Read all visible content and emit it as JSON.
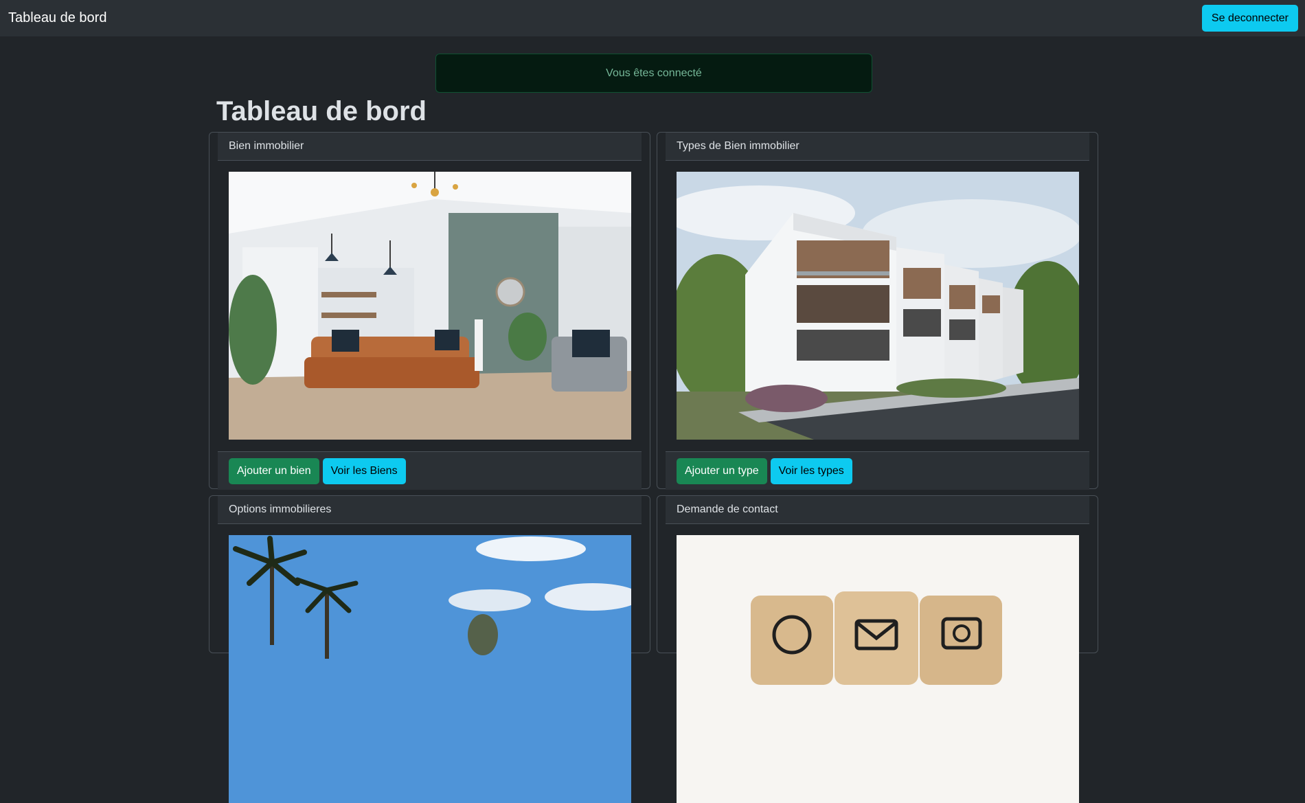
{
  "navbar": {
    "brand": "Tableau de bord",
    "logout_label": "Se deconnecter"
  },
  "alert": {
    "message": "Vous êtes connecté"
  },
  "page": {
    "title": "Tableau de bord"
  },
  "cards": {
    "biens": {
      "title": "Bien immobilier",
      "add_label": "Ajouter un bien",
      "view_label": "Voir les Biens"
    },
    "types": {
      "title": "Types de Bien immobilier",
      "add_label": "Ajouter un type",
      "view_label": "Voir les types"
    },
    "options": {
      "title": "Options immobilieres"
    },
    "contact": {
      "title": "Demande de contact"
    }
  },
  "colors": {
    "background": "#212529",
    "navbar": "#2b3035",
    "info": "#0dcaf0",
    "success": "#198754",
    "alert_bg": "#051b11",
    "alert_text": "#75b798"
  }
}
